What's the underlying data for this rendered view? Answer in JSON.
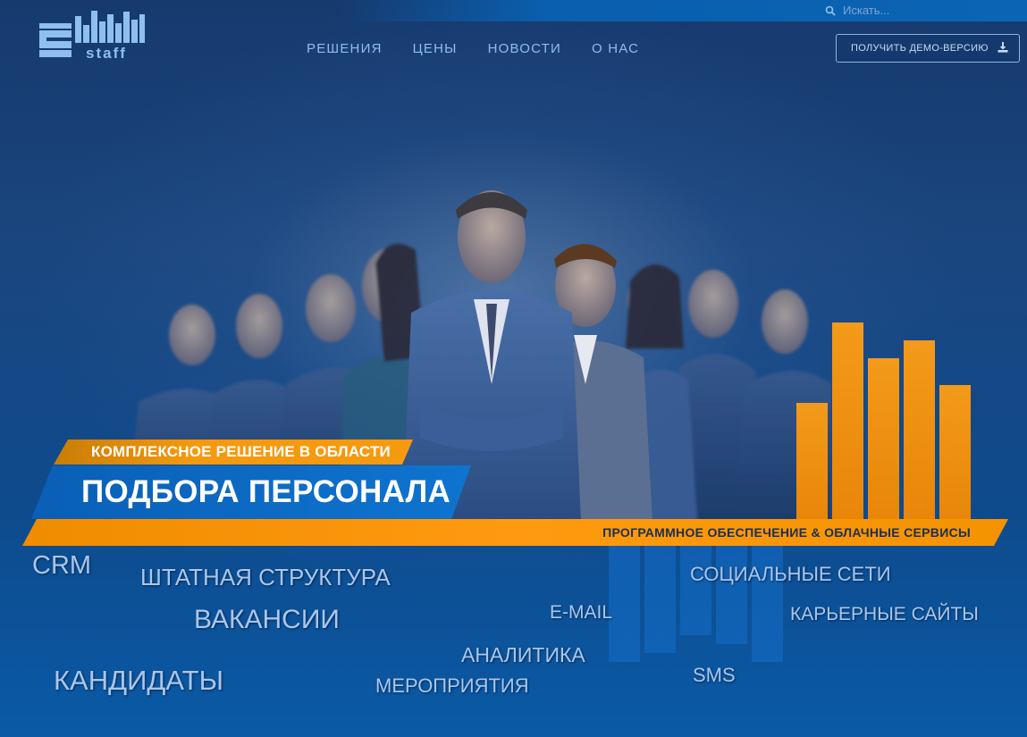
{
  "search": {
    "placeholder": "Искать..."
  },
  "logo": {
    "text": "staff",
    "letter": "e"
  },
  "nav": {
    "items": [
      {
        "label": "РЕШЕНИЯ"
      },
      {
        "label": "ЦЕНЫ"
      },
      {
        "label": "НОВОСТИ"
      },
      {
        "label": "О НАС"
      }
    ]
  },
  "demo_button": {
    "label": "ПОЛУЧИТЬ ДЕМО-ВЕРСИЮ"
  },
  "hero": {
    "subtitle": "КОМПЛЕКСНОЕ РЕШЕНИЕ В ОБЛАСТИ",
    "title": "ПОДБОРА ПЕРСОНАЛА",
    "tagline": "ПРОГРАММНОЕ ОБЕСПЕЧЕНИЕ & ОБЛАЧНЫЕ СЕРВИСЫ"
  },
  "keywords": {
    "crm": "CRM",
    "staff_structure": "ШТАТНАЯ СТРУКТУРА",
    "vacancies": "ВАКАНСИИ",
    "candidates": "КАНДИДАТЫ",
    "email": "E-MAIL",
    "analytics": "АНАЛИТИКА",
    "events": "МЕРОПРИЯТИЯ",
    "social": "СОЦИАЛЬНЫЕ СЕТИ",
    "career_sites": "КАРЬЕРНЫЕ САЙТЫ",
    "sms": "SMS"
  },
  "colors": {
    "accent_orange": "#f59a0e",
    "accent_blue": "#0d6cc6",
    "background": "#163a6e",
    "nav_text": "#8fbdf0"
  }
}
